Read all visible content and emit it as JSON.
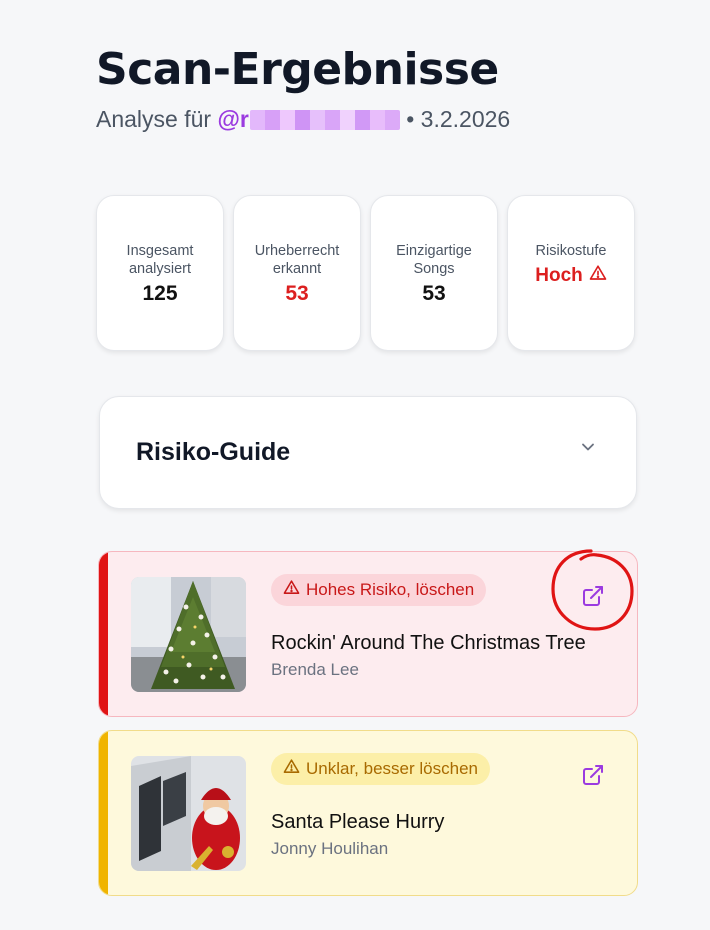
{
  "header": {
    "title": "Scan-Ergebnisse",
    "subtitle_prefix": "Analyse für",
    "handle_visible": "@r",
    "separator_date": "• 3.2.2026"
  },
  "stats": [
    {
      "label_line1": "Insgesamt",
      "label_line2": "analysiert",
      "value": "125",
      "color": "#111111"
    },
    {
      "label_line1": "Urheberrecht",
      "label_line2": "erkannt",
      "value": "53",
      "color": "#dc1f1f"
    },
    {
      "label_line1": "Einzigartige",
      "label_line2": "Songs",
      "value": "53",
      "color": "#111111"
    },
    {
      "label_line1": "Risikostufe",
      "value": "Hoch",
      "icon": "warning-icon",
      "color": "#dc1f1f"
    }
  ],
  "guide": {
    "title": "Risiko-Guide",
    "expanded": false,
    "icon": "chevron-down-icon"
  },
  "songs": [
    {
      "badge": "Hohes Risiko, löschen",
      "badge_icon": "warning-icon",
      "title": "Rockin' Around The Christmas Tree",
      "artist": "Brenda Lee",
      "level": "high",
      "accent": "#e01414",
      "thumbnail": "christmas-tree",
      "action_icon": "external-link-icon"
    },
    {
      "badge": "Unklar, besser löschen",
      "badge_icon": "warning-icon",
      "title": "Santa Please Hurry",
      "artist": "Jonny Houlihan",
      "level": "unclear",
      "accent": "#f0b400",
      "thumbnail": "chocolate-santa",
      "action_icon": "external-link-icon"
    }
  ],
  "colors": {
    "brand": "#9b3be0",
    "danger": "#dc1f1f",
    "warning": "#f0b400"
  }
}
